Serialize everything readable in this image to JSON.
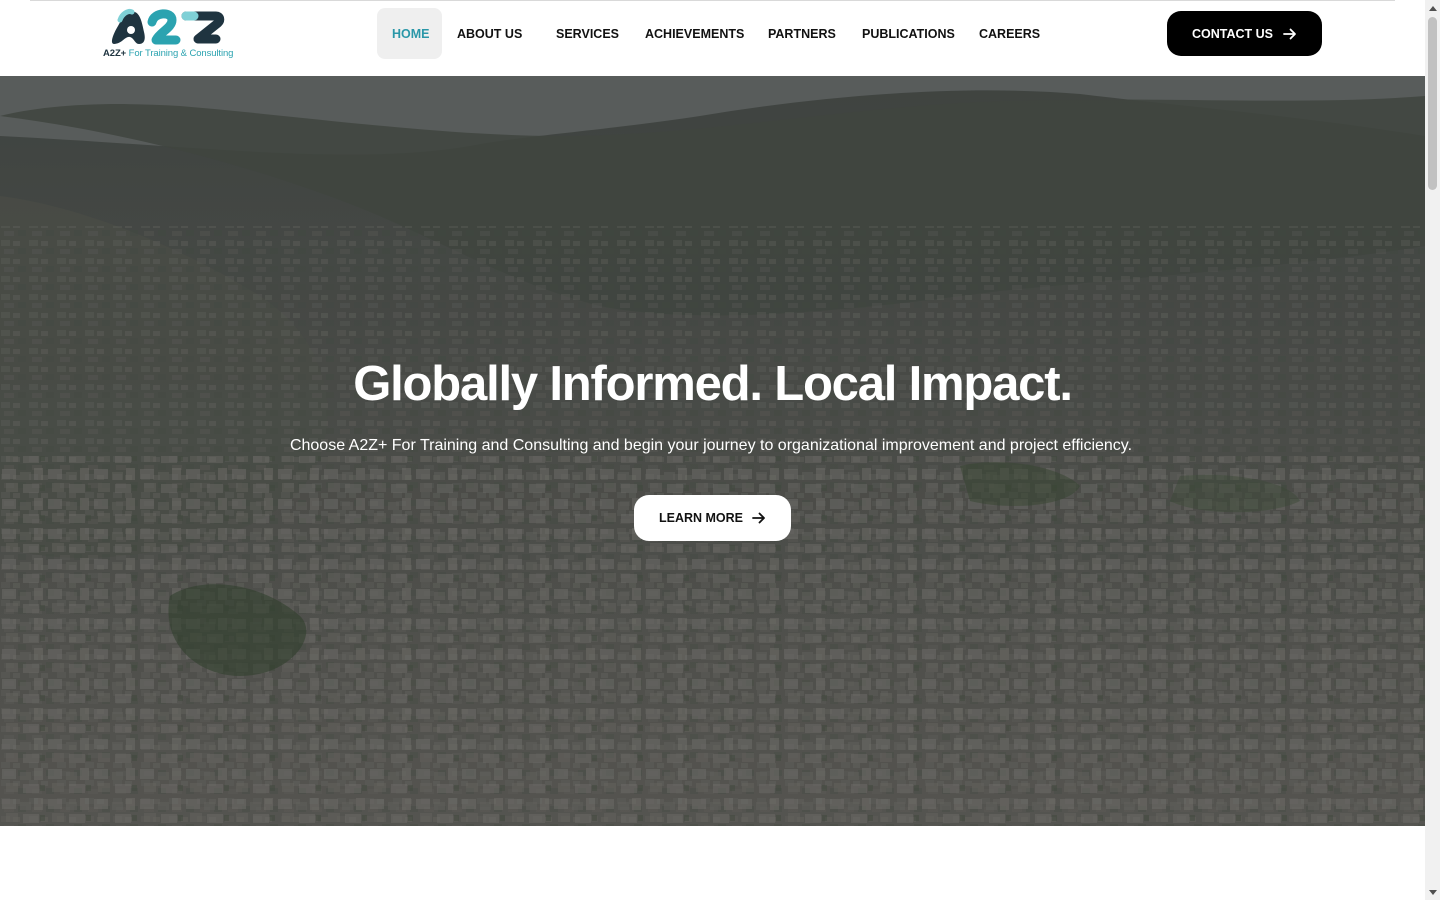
{
  "header": {
    "logo": {
      "mark_text": "A2Z",
      "tagline_brand": "A2Z+",
      "tagline_rest": "For Training & Consulting",
      "colors": {
        "dark": "#1f3440",
        "teal": "#2ba3b0",
        "light_teal": "#7fd0d6"
      }
    },
    "nav": [
      {
        "label": "HOME",
        "active": true
      },
      {
        "label": "ABOUT US",
        "active": false
      },
      {
        "label": "SERVICES",
        "active": false
      },
      {
        "label": "ACHIEVEMENTS",
        "active": false
      },
      {
        "label": "PARTNERS",
        "active": false
      },
      {
        "label": "PUBLICATIONS",
        "active": false
      },
      {
        "label": "CAREERS",
        "active": false
      }
    ],
    "contact_button": {
      "label": "CONTACT US",
      "icon": "arrow-right-icon"
    }
  },
  "hero": {
    "background": "aerial-city-photo",
    "title": "Globally Informed. Local Impact.",
    "subtitle": "Choose A2Z+ For Training and Consulting and begin your journey to organizational improvement and project efficiency.",
    "cta": {
      "label": "LEARN MORE",
      "icon": "arrow-right-icon"
    }
  },
  "colors": {
    "accent": "#2a97a8",
    "button_dark": "#000000",
    "button_light": "#ffffff"
  }
}
